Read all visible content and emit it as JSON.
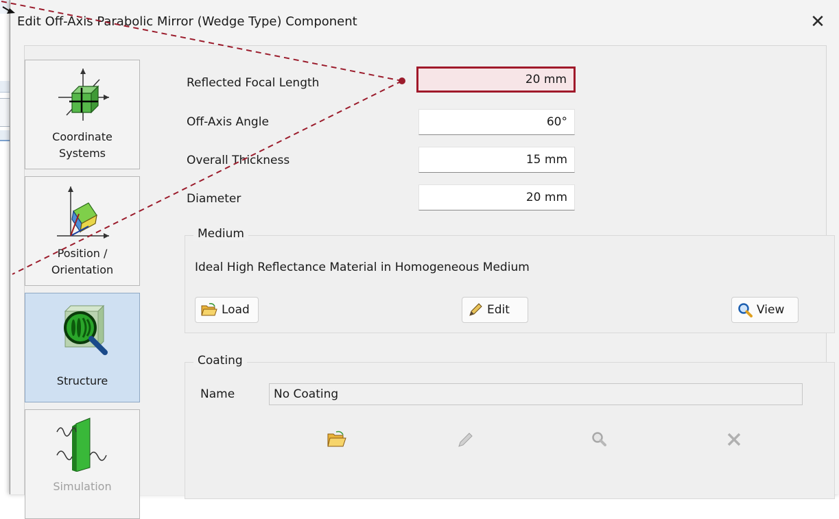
{
  "dialog": {
    "title": "Edit Off-Axis Parabolic Mirror (Wedge Type) Component",
    "close_glyph": "✕"
  },
  "nav": {
    "items": [
      {
        "label": "Coordinate\nSystems",
        "icon": "coordinate-systems-icon"
      },
      {
        "label": "Position /\nOrientation",
        "icon": "position-orientation-icon"
      },
      {
        "label": "Structure",
        "icon": "structure-icon",
        "selected": true
      },
      {
        "label": "Simulation",
        "icon": "simulation-icon",
        "disabled": true
      }
    ]
  },
  "fields": [
    {
      "label": "Reflected Focal Length",
      "value": "20 mm",
      "highlighted": true
    },
    {
      "label": "Off-Axis Angle",
      "value": "60°"
    },
    {
      "label": "Overall Thickness",
      "value": "15 mm"
    },
    {
      "label": "Diameter",
      "value": "20 mm"
    }
  ],
  "medium": {
    "title": "Medium",
    "description": "Ideal High Reflectance Material in Homogeneous Medium",
    "buttons": {
      "load": "Load",
      "edit": "Edit",
      "view": "View"
    }
  },
  "coating": {
    "title": "Coating",
    "name_label": "Name",
    "name_value": "No Coating"
  },
  "colors": {
    "highlight_border": "#a0192a",
    "highlight_fill": "#f7e5e7",
    "nav_selected": "#cfe0f2",
    "annotation_arrow": "#9b1c2c"
  }
}
